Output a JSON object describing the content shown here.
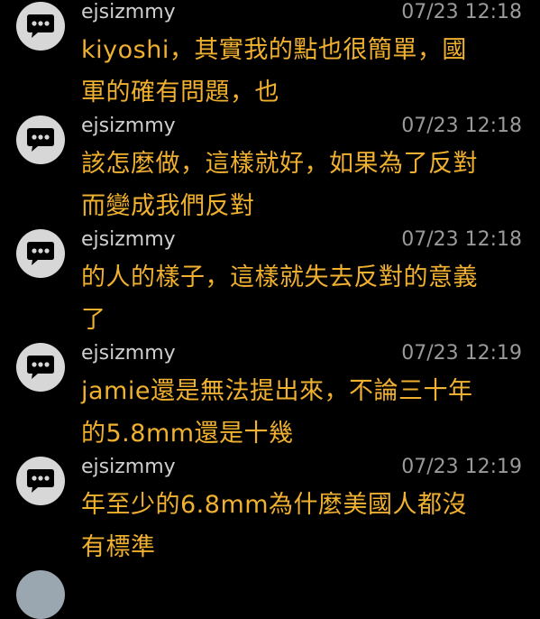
{
  "comments": [
    {
      "username": "ejsizmmy",
      "timestamp": "07/23 12:18",
      "line1": "kiyoshi，其實我的點也很簡單，國",
      "line2": "軍的確有問題，也"
    },
    {
      "username": "ejsizmmy",
      "timestamp": "07/23 12:18",
      "line1": "該怎麼做，這樣就好，如果為了反對",
      "line2": "而變成我們反對"
    },
    {
      "username": "ejsizmmy",
      "timestamp": "07/23 12:18",
      "line1": "的人的樣子，這樣就失去反對的意義",
      "line2": "了"
    },
    {
      "username": "ejsizmmy",
      "timestamp": "07/23 12:19",
      "line1": "jamie還是無法提出來，不論三十年",
      "line2": "的5.8mm還是十幾"
    },
    {
      "username": "ejsizmmy",
      "timestamp": "07/23 12:19",
      "line1": "年至少的6.8mm為什麼美國人都沒",
      "line2": "有標準"
    }
  ],
  "colors": {
    "background": "#000000",
    "username": "#cfcfcf",
    "timestamp": "#9a9a9a",
    "message": "#f0b030",
    "avatar": "#d7d7d7"
  },
  "icons": {
    "avatar": "chat-bubble-icon"
  }
}
